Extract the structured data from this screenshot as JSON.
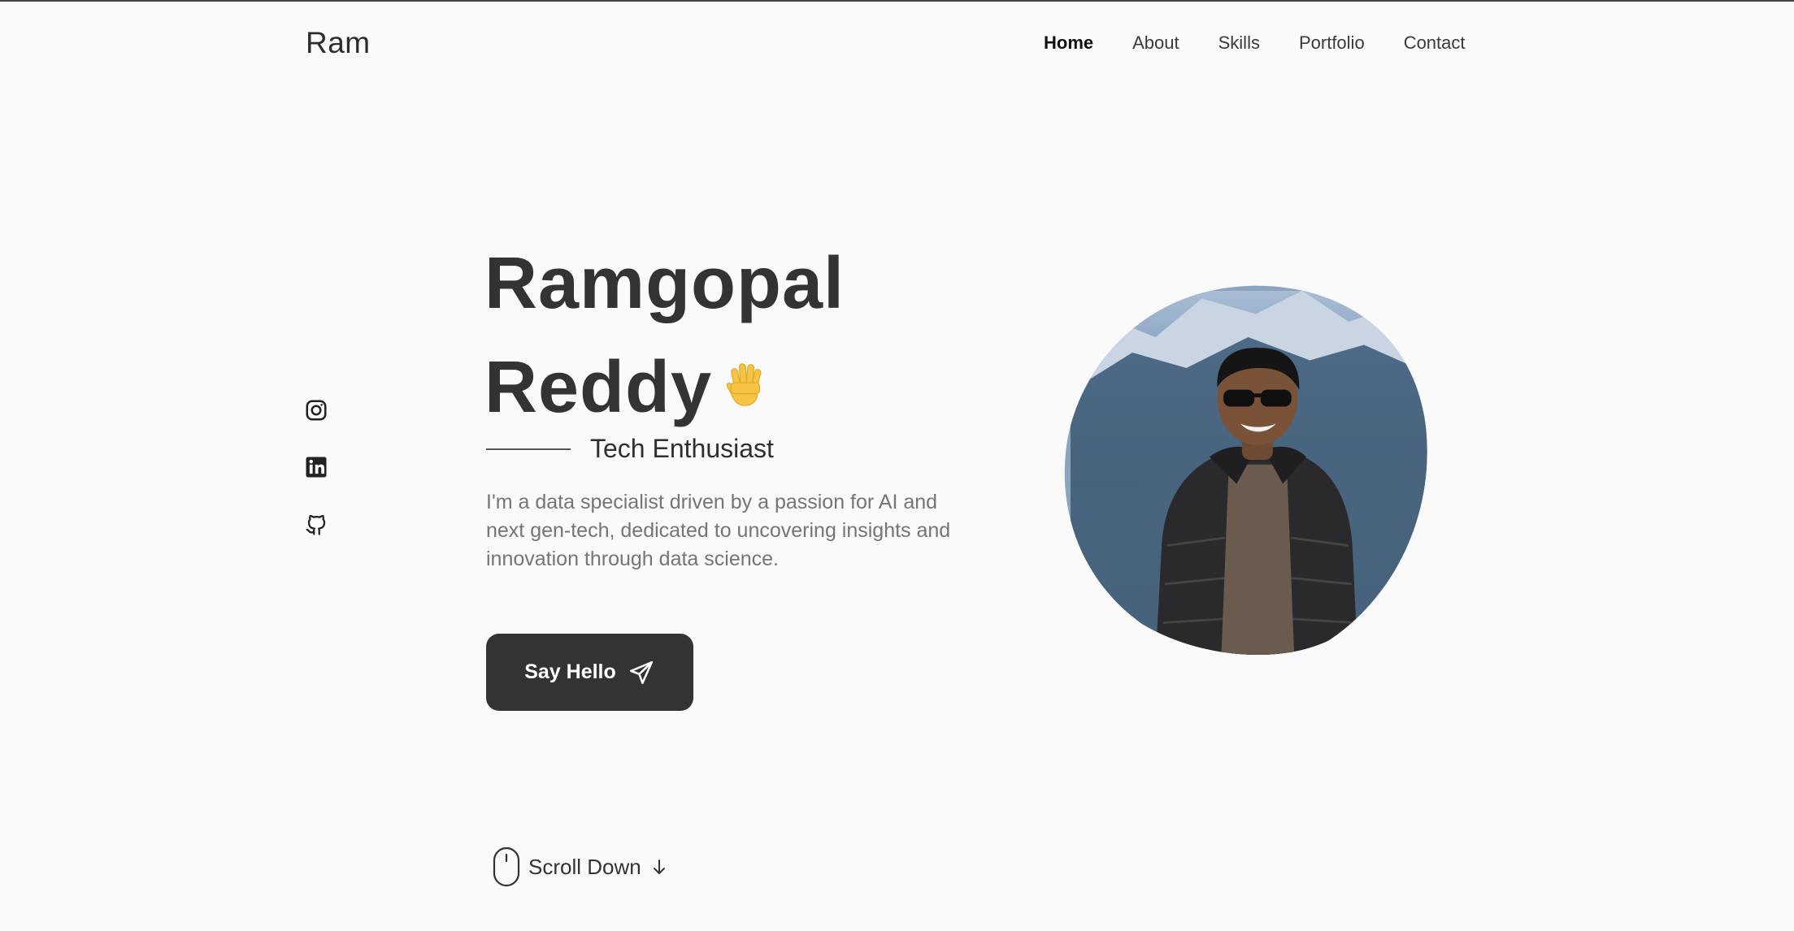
{
  "header": {
    "logo": "Ram",
    "nav": [
      {
        "label": "Home",
        "active": true
      },
      {
        "label": "About",
        "active": false
      },
      {
        "label": "Skills",
        "active": false
      },
      {
        "label": "Portfolio",
        "active": false
      },
      {
        "label": "Contact",
        "active": false
      }
    ]
  },
  "social": [
    {
      "icon": "instagram-icon"
    },
    {
      "icon": "linkedin-icon"
    },
    {
      "icon": "github-icon"
    }
  ],
  "hero": {
    "name_line1": "Ramgopal",
    "name_line2": "Reddy",
    "wave_icon": "waving-hand-icon",
    "subtitle": "Tech Enthusiast",
    "description": "I'm a data specialist driven by a passion for AI and next gen-tech, dedicated to uncovering insights and innovation through data science.",
    "button_label": "Say Hello",
    "button_icon": "send-icon"
  },
  "scroll": {
    "label": "Scroll Down",
    "icons": [
      "mouse-icon",
      "arrow-down-icon"
    ]
  },
  "profile": {
    "image": "profile-photo",
    "blob_color": "#8aa3bf"
  },
  "colors": {
    "background": "#fafafa",
    "text": "#333333",
    "muted": "#757575",
    "button": "#333333",
    "wave": "#f6c343"
  }
}
